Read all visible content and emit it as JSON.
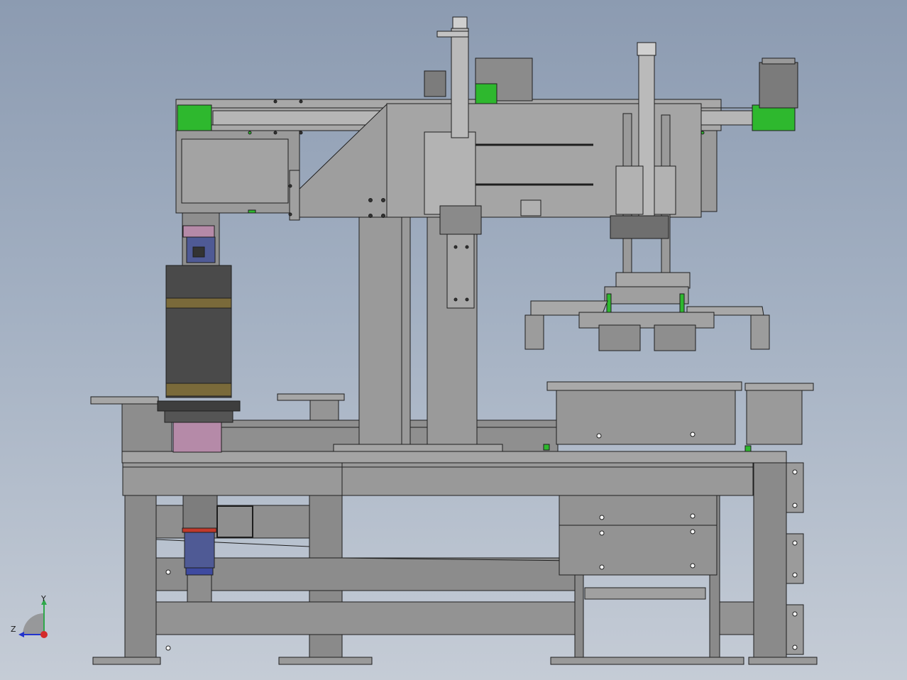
{
  "viewport": {
    "background_top": "#8c9bb1",
    "background_bottom": "#c5ccd6"
  },
  "colors": {
    "steel": "#8e8e8e",
    "steel_light": "#a2a2a2",
    "steel_dark": "#6f6f6f",
    "outline": "#1e1e1e",
    "accent_green": "#2eb82e",
    "motor_pink": "#b58aa8",
    "cylinder_blue": "#4f5a95",
    "red_marker": "#c0392b"
  },
  "triad": {
    "y_label": "Y",
    "z_label": "Z",
    "icon": "coordinate-triad-icon"
  }
}
